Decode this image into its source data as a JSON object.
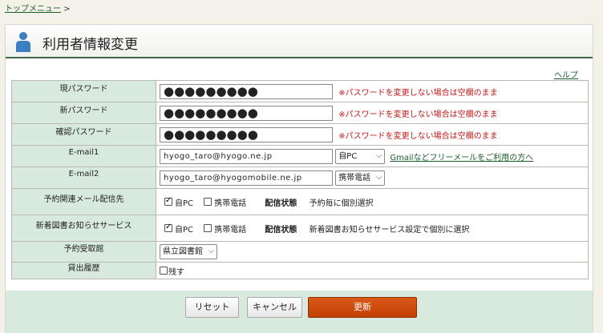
{
  "breadcrumb": {
    "top_menu": "トップメニュー",
    "separator": ">"
  },
  "page": {
    "title": "利用者情報変更",
    "help": "ヘルプ"
  },
  "form": {
    "current_password": {
      "label": "現パスワード",
      "value": "●●●●●●●●●",
      "note": "※パスワードを変更しない場合は空欄のまま"
    },
    "new_password": {
      "label": "新パスワード",
      "value": "●●●●●●●●●",
      "note": "※パスワードを変更しない場合は空欄のまま"
    },
    "confirm_password": {
      "label": "確認パスワード",
      "value": "●●●●●●●●●",
      "note": "※パスワードを変更しない場合は空欄のまま"
    },
    "email1": {
      "label": "E-mail1",
      "value": "hyogo_taro@hyogo.ne.jp",
      "type": "自PC",
      "link": "Gmailなどフリーメールをご利用の方へ"
    },
    "email2": {
      "label": "E-mail2",
      "value": "hyogo_taro@hyogomobile.ne.jp",
      "type": "携帯電話"
    },
    "reservation_mail": {
      "label": "予約関連メール配信先",
      "option_pc": "自PC",
      "option_pc_checked": true,
      "option_mobile": "携帯電話",
      "option_mobile_checked": false,
      "status_label": "配信状態",
      "status_value": "予約毎に個別選択"
    },
    "new_books": {
      "label": "新着図書お知らせサービス",
      "option_pc": "自PC",
      "option_pc_checked": true,
      "option_mobile": "携帯電話",
      "option_mobile_checked": false,
      "status_label": "配信状態",
      "status_value": "新着図書お知らせサービス設定で個別に選択"
    },
    "pickup_library": {
      "label": "予約受取館",
      "value": "県立図書館"
    },
    "loan_history": {
      "label": "貸出履歴",
      "option": "残す",
      "checked": false
    }
  },
  "buttons": {
    "reset": "リセット",
    "cancel": "キャンセル",
    "update": "更新"
  },
  "colors": {
    "accent": "#3c6b49",
    "label_bg": "#d8eadd",
    "note": "#c21a1a",
    "primary": "#c8470d"
  }
}
